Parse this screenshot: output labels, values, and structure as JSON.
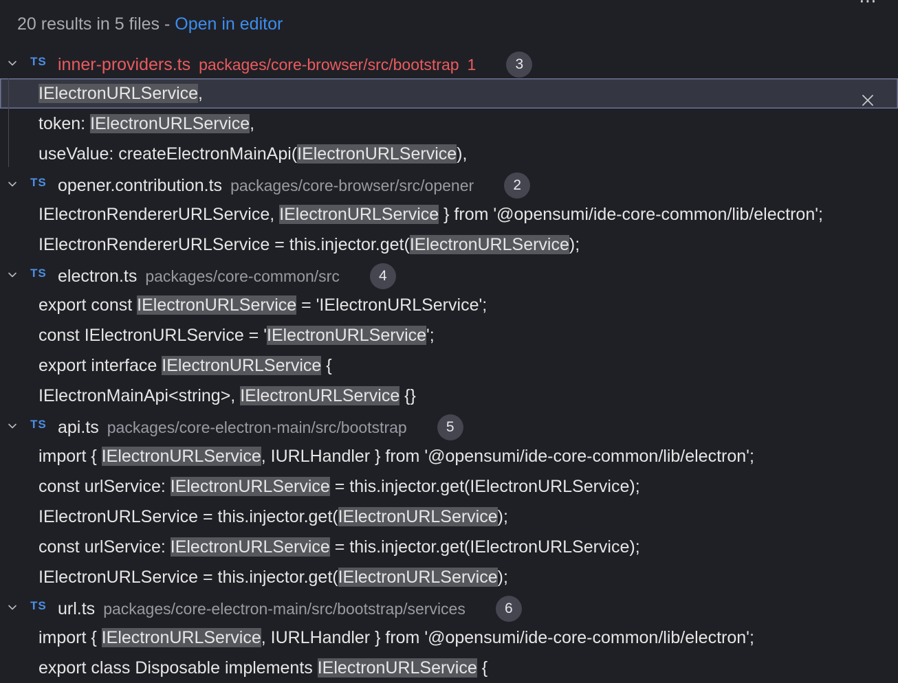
{
  "summary": {
    "count_text": "20 results in 5 files - ",
    "open_link": "Open in editor"
  },
  "more_icon_glyph": "⋯",
  "files": [
    {
      "lang": "TS",
      "name": "inner-providers.ts",
      "path": "packages/core-browser/src/bootstrap",
      "problems": "1",
      "count": "3",
      "error": true,
      "matches": [
        {
          "pre": "",
          "hl": "IElectronURLService",
          "post": ",",
          "selected": true
        },
        {
          "pre": "token: ",
          "hl": "IElectronURLService",
          "post": ","
        },
        {
          "pre": "useValue: createElectronMainApi(",
          "hl": "IElectronURLService",
          "post": "),"
        }
      ]
    },
    {
      "lang": "TS",
      "name": "opener.contribution.ts",
      "path": "packages/core-browser/src/opener",
      "count": "2",
      "matches": [
        {
          "pre": "IElectronRendererURLService, ",
          "hl": "IElectronURLService",
          "post": " } from '@opensumi/ide-core-common/lib/electron';"
        },
        {
          "pre": "IElectronRendererURLService = this.injector.get(",
          "hl": "IElectronURLService",
          "post": ");"
        }
      ]
    },
    {
      "lang": "TS",
      "name": "electron.ts",
      "path": "packages/core-common/src",
      "count": "4",
      "matches": [
        {
          "pre": "export const ",
          "hl": "IElectronURLService",
          "post": " = 'IElectronURLService';"
        },
        {
          "pre": "const IElectronURLService = '",
          "hl": "IElectronURLService",
          "post": "';"
        },
        {
          "pre": "export interface ",
          "hl": "IElectronURLService",
          "post": " {"
        },
        {
          "pre": "IElectronMainApi<string>, ",
          "hl": "IElectronURLService",
          "post": " {}"
        }
      ]
    },
    {
      "lang": "TS",
      "name": "api.ts",
      "path": "packages/core-electron-main/src/bootstrap",
      "count": "5",
      "matches": [
        {
          "pre": "import { ",
          "hl": "IElectronURLService",
          "post": ", IURLHandler } from '@opensumi/ide-core-common/lib/electron';"
        },
        {
          "pre": "const urlService: ",
          "hl": "IElectronURLService",
          "post": " = this.injector.get(IElectronURLService);"
        },
        {
          "pre": "IElectronURLService = this.injector.get(",
          "hl": "IElectronURLService",
          "post": ");"
        },
        {
          "pre": "const urlService: ",
          "hl": "IElectronURLService",
          "post": " = this.injector.get(IElectronURLService);"
        },
        {
          "pre": "IElectronURLService = this.injector.get(",
          "hl": "IElectronURLService",
          "post": ");"
        }
      ]
    },
    {
      "lang": "TS",
      "name": "url.ts",
      "path": "packages/core-electron-main/src/bootstrap/services",
      "count": "6",
      "matches": [
        {
          "pre": "import { ",
          "hl": "IElectronURLService",
          "post": ", IURLHandler } from '@opensumi/ide-core-common/lib/electron';"
        },
        {
          "pre": "export class Disposable implements ",
          "hl": "IElectronURLService",
          "post": " {"
        }
      ]
    }
  ]
}
